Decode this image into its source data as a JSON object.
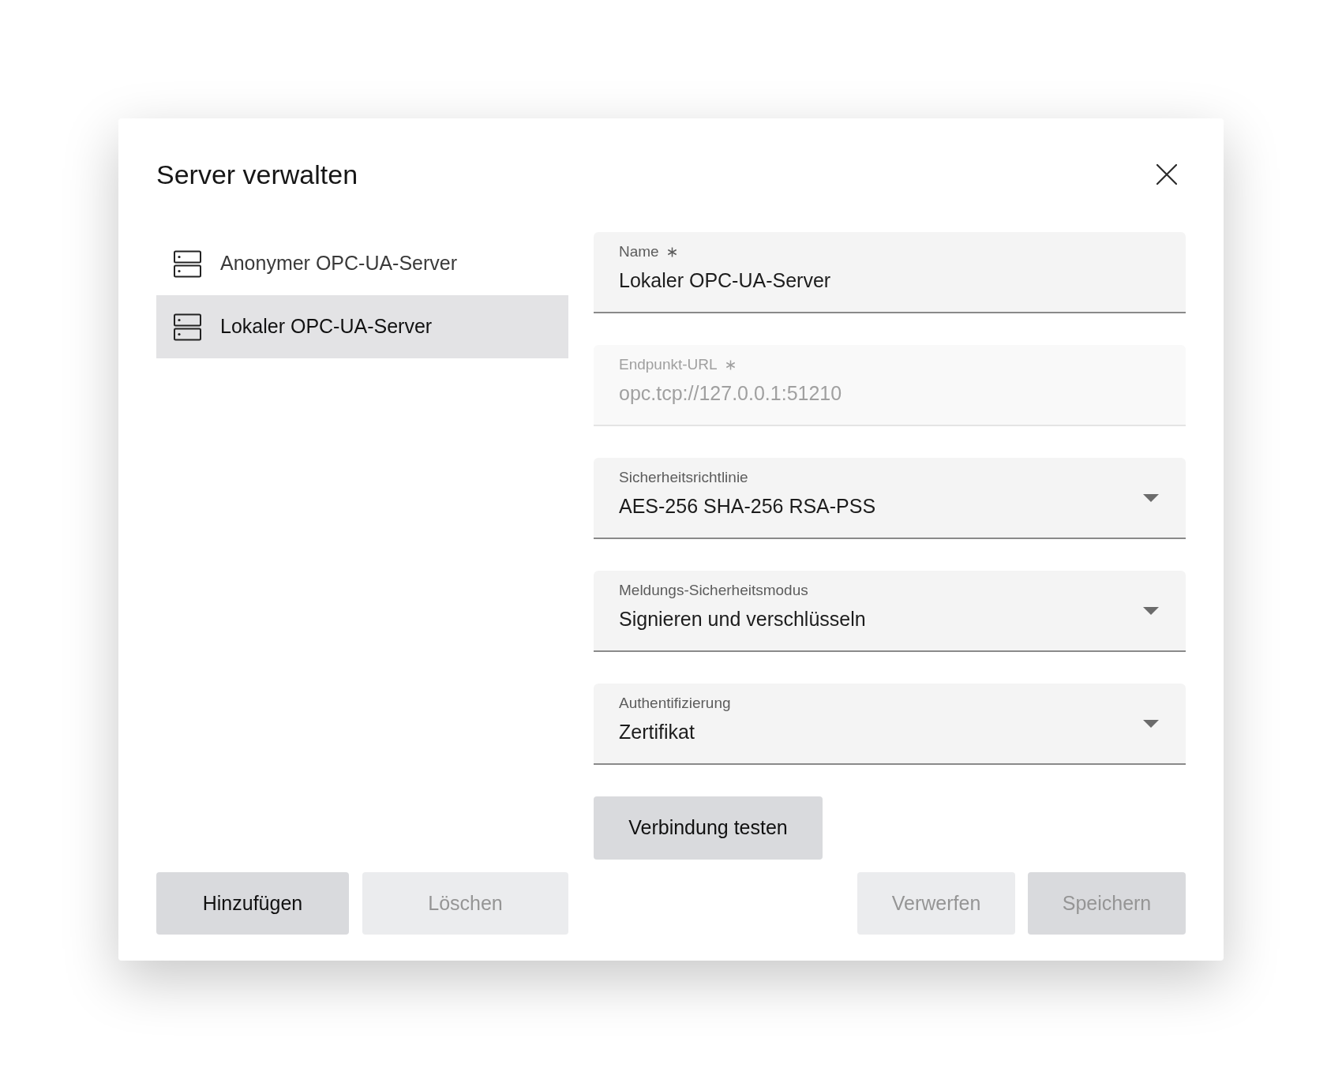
{
  "dialog": {
    "title": "Server verwalten"
  },
  "servers": [
    {
      "name": "Anonymer OPC-UA-Server",
      "selected": false
    },
    {
      "name": "Lokaler OPC-UA-Server",
      "selected": true
    }
  ],
  "fields": [
    {
      "kind": "text",
      "label": "Name",
      "value": "Lokaler OPC-UA-Server",
      "required": true,
      "disabled": false
    },
    {
      "kind": "text",
      "label": "Endpunkt-URL",
      "value": "opc.tcp://127.0.0.1:51210",
      "required": true,
      "disabled": true
    },
    {
      "kind": "select",
      "label": "Sicherheitsrichtlinie",
      "value": "AES-256 SHA-256 RSA-PSS",
      "required": false,
      "disabled": false
    },
    {
      "kind": "select",
      "label": "Meldungs-Sicherheitsmodus",
      "value": "Signieren und verschlüsseln",
      "required": false,
      "disabled": false
    },
    {
      "kind": "select",
      "label": "Authentifizierung",
      "value": "Zertifikat",
      "required": false,
      "disabled": false
    }
  ],
  "test_button": {
    "label": "Verbindung testen",
    "kind": "primary",
    "disabled": false
  },
  "list_buttons": [
    {
      "label": "Hinzufügen",
      "kind": "primary",
      "disabled": false
    },
    {
      "label": "Löschen",
      "kind": "secondary",
      "disabled": true
    }
  ],
  "form_buttons": [
    {
      "label": "Verwerfen",
      "kind": "secondary",
      "disabled": true
    },
    {
      "label": "Speichern",
      "kind": "primary",
      "disabled": true
    }
  ]
}
